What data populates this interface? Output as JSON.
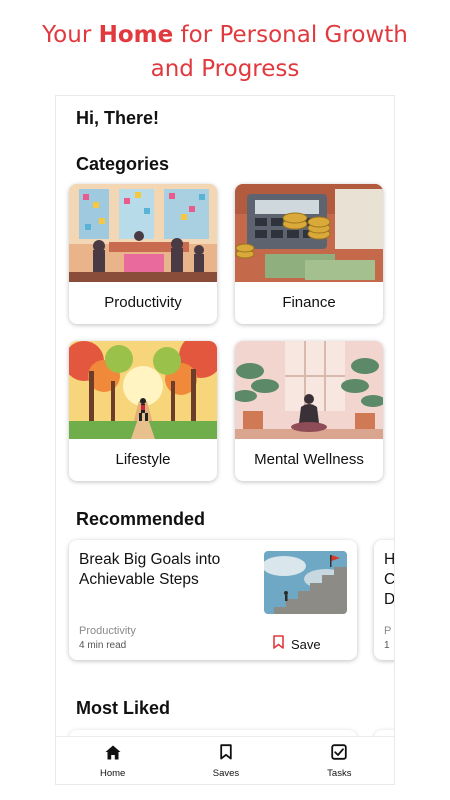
{
  "hero": {
    "pre": "Your ",
    "bold": "Home",
    "post": " for Personal Growth",
    "line2": "and Progress"
  },
  "greeting": "Hi, There!",
  "sections": {
    "categories": "Categories",
    "recommended": "Recommended",
    "most_liked": "Most Liked"
  },
  "categories": [
    {
      "label": "Productivity"
    },
    {
      "label": "Finance"
    },
    {
      "label": "Lifestyle"
    },
    {
      "label": "Mental Wellness"
    }
  ],
  "recommended": [
    {
      "title": "Break Big Goals into Achievable Steps",
      "category": "Productivity",
      "read_time": "4 min read",
      "save_label": "Save"
    }
  ],
  "recommended_peek": {
    "title": "H\nC\nD",
    "category": "P",
    "read_time": "1"
  },
  "tabs": [
    {
      "label": "Home",
      "icon": "home-icon"
    },
    {
      "label": "Saves",
      "icon": "bookmark-icon"
    },
    {
      "label": "Tasks",
      "icon": "checkbox-icon"
    }
  ],
  "colors": {
    "accent": "#e0393e",
    "text": "#111111",
    "muted": "#8a8a8a"
  }
}
